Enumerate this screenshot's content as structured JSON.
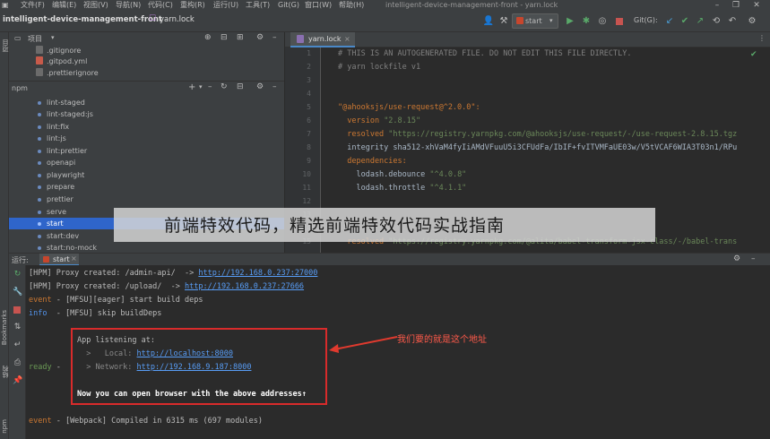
{
  "menu": {
    "items": [
      "文件(F)",
      "编辑(E)",
      "视图(V)",
      "导航(N)",
      "代码(C)",
      "重构(R)",
      "运行(U)",
      "工具(T)",
      "Git(G)",
      "窗口(W)",
      "帮助(H)"
    ],
    "window_title": "intelligent-device-management-front - yarn.lock"
  },
  "navbar": {
    "project_name": "intelligent-device-management-front",
    "file_name": "yarn.lock",
    "run_config": "start",
    "git_label": "Git(G):"
  },
  "left_strip": {
    "project_label": "项目",
    "bookmarks_label": "Bookmarks",
    "structure_label": "结构",
    "npm_label": "npm"
  },
  "project_panel": {
    "title": "项目",
    "files": [
      ".gitignore",
      ".gitpod.yml",
      ".prettierignore"
    ]
  },
  "npm_panel": {
    "title": "npm",
    "scripts": [
      "lint-staged",
      "lint-staged:js",
      "lint:fix",
      "lint:js",
      "lint:prettier",
      "openapi",
      "playwright",
      "prepare",
      "prettier",
      "serve",
      "start",
      "start:dev",
      "start:no-mock"
    ],
    "selected": "start"
  },
  "editor": {
    "tab_label": "yarn.lock",
    "line_numbers": [
      "1",
      "2",
      "3",
      "4",
      "5",
      "6",
      "7",
      "8",
      "9",
      "10",
      "11",
      "12",
      "13",
      "14",
      "15"
    ],
    "lines": {
      "l1": "# THIS IS AN AUTOGENERATED FILE. DO NOT EDIT THIS FILE DIRECTLY.",
      "l2": "# yarn lockfile v1",
      "l5_key": "\"@ahooksjs/use-request@^2.0.0\":",
      "l6_key": "  version ",
      "l6_val": "\"2.8.15\"",
      "l7_key": "  resolved ",
      "l7_val": "\"https://registry.yarnpkg.com/@ahooksjs/use-request/-/use-request-2.8.15.tgz",
      "l8": "  integrity sha512-xhVaM4fyIiAMdVFuuU5i3CFUdFa/IbIF+fvITVMFaUE03w/V5tVCAF6WIA3T03n1/RPu",
      "l9_key": "  dependencies:",
      "l10_name": "    lodash.debounce ",
      "l10_val": "\"^4.0.8\"",
      "l11_name": "    lodash.throttle ",
      "l11_val": "\"^4.1.1\"",
      "l14_key": "  resolved ",
      "l14_val": "\"https://registry.yarnpkg.com/@alita/babel-transform-jsx-class/-/babel-trans"
    }
  },
  "run_panel": {
    "label": "运行:",
    "tab": "start",
    "console": {
      "hpm1_prefix": "[HPM] Proxy created: /admin-api/  -> ",
      "hpm1_link": "http://192.168.0.237:27000",
      "hpm2_prefix": "[HPM] Proxy created: /upload/  -> ",
      "hpm2_link": "http://192.168.0.237:27666",
      "event1_tag": "event",
      "event1_text": " - [MFSU][eager] start build deps",
      "info_tag": "info",
      "info_text": "  - [MFSU] skip buildDeps",
      "app_listening": "App listening at:",
      "local_label": "  >   Local: ",
      "local_link": "http://localhost:8000",
      "ready_tag": "ready",
      "ready_dash": " - ",
      "network_label": "  > Network: ",
      "network_link": "http://192.168.9.187:8000",
      "open_browser": "Now you can open browser with the above addresses↑",
      "event2_tag": "event",
      "event2_text": " - [Webpack] Compiled in 6315 ms (697 modules)"
    },
    "annotation": "我们要的就是这个地址"
  },
  "watermark": "前端特效代码，精选前端特效代码实战指南",
  "colors": {
    "accent": "#2f65ca",
    "highlight_box": "#d92b2b",
    "annotation": "#ff5a4a",
    "link": "#589df6"
  }
}
